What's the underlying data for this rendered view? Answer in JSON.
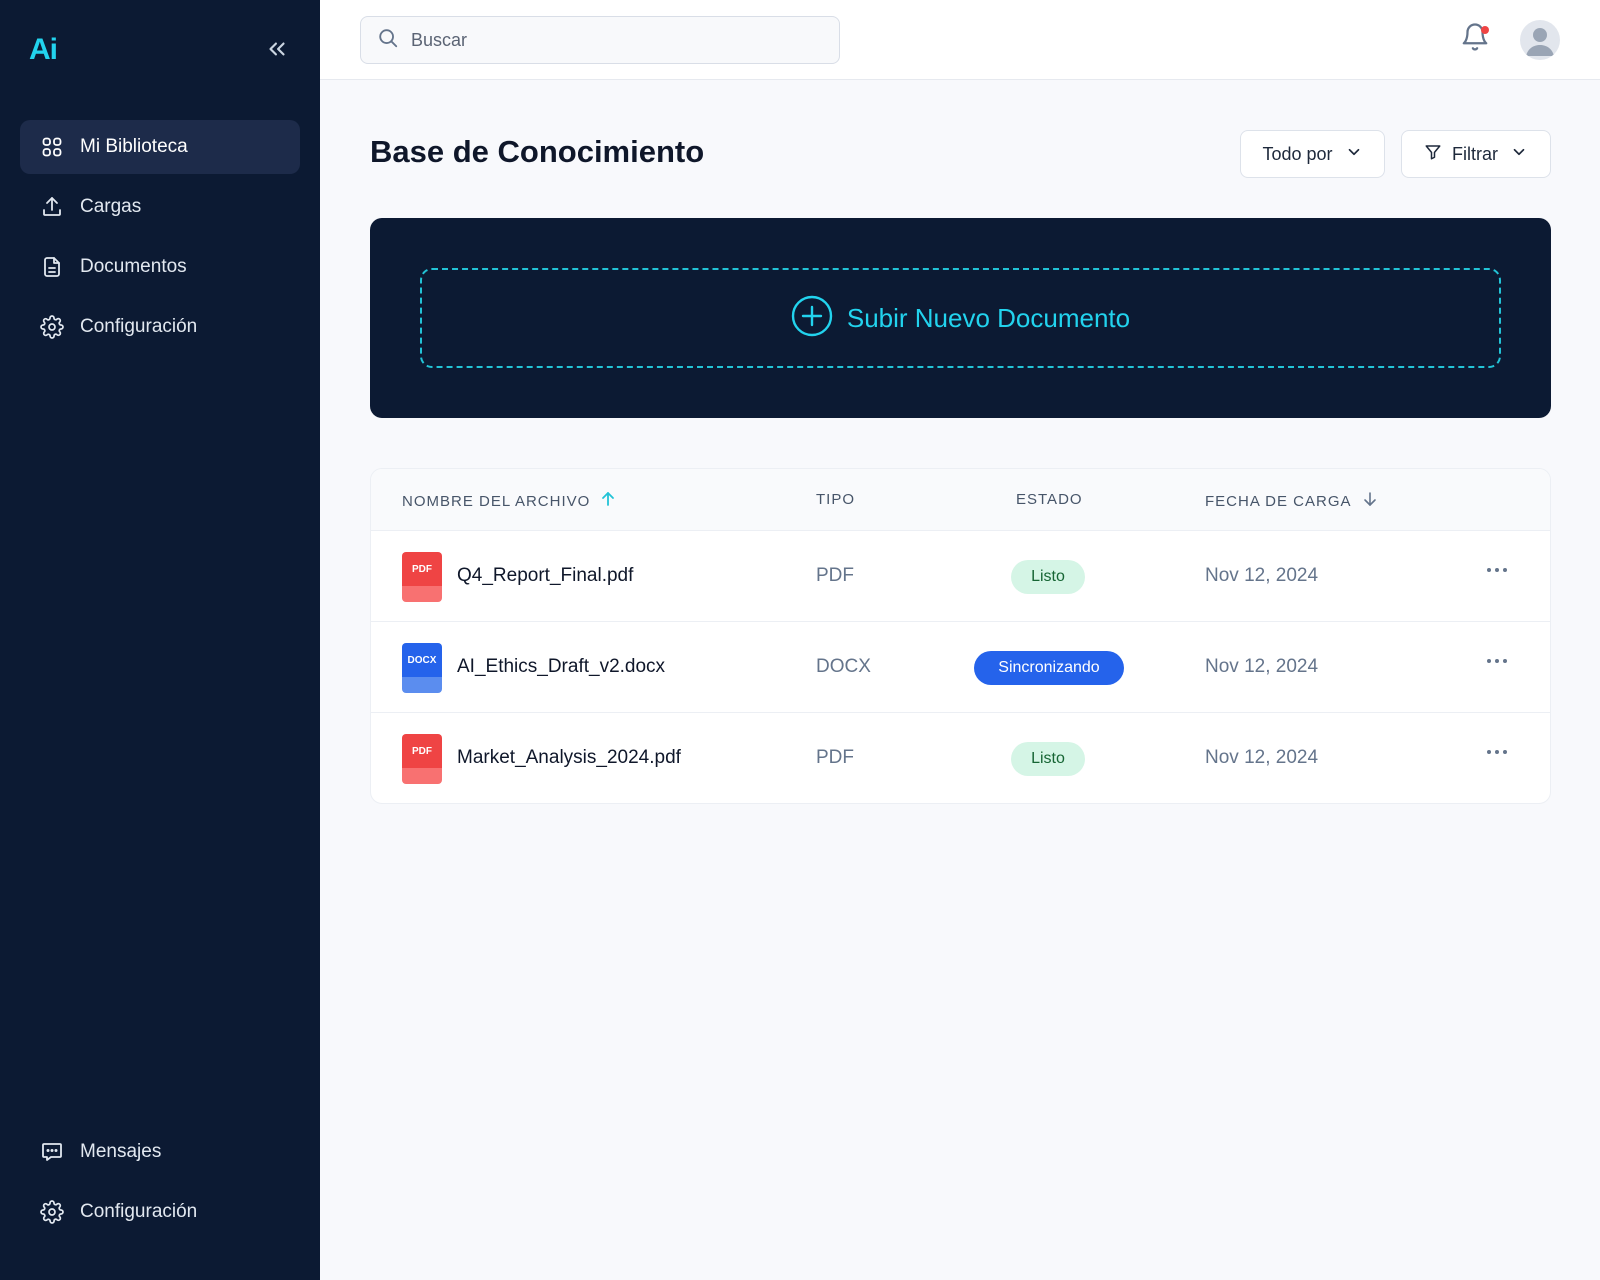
{
  "brand": {
    "logo": "Ai",
    "accent": "#22d3ee",
    "sidebar_bg": "#0c1a33"
  },
  "sidebar": {
    "items": [
      {
        "label": "Mi Biblioteca",
        "icon": "grid-icon",
        "active": true
      },
      {
        "label": "Cargas",
        "icon": "upload-icon",
        "active": false
      },
      {
        "label": "Documentos",
        "icon": "document-icon",
        "active": false
      },
      {
        "label": "Configuración",
        "icon": "gear-icon",
        "active": false
      }
    ],
    "bottom_items": [
      {
        "label": "Mensajes",
        "icon": "message-icon"
      },
      {
        "label": "Configuración",
        "icon": "gear-icon"
      }
    ]
  },
  "topbar": {
    "search_placeholder": "Buscar",
    "notifications_unread": true
  },
  "main": {
    "title": "Base de Conocimiento",
    "sort_label": "Todo por",
    "filter_label": "Filtrar",
    "upload_label": "Subir Nuevo Documento"
  },
  "table": {
    "headers": {
      "name": "NOMBRE DEL ARCHIVO",
      "type": "TIPO",
      "status": "ESTADO",
      "date": "FECHA DE CARGA"
    },
    "rows": [
      {
        "icon": "PDF",
        "name": "Q4_Report_Final.pdf",
        "type": "PDF",
        "status": "Listo",
        "date": "Nov 12, 2024"
      },
      {
        "icon": "DOCX",
        "name": "AI_Ethics_Draft_v2.docx",
        "type": "DOCX",
        "status": "Sincronizando",
        "date": "Nov 12, 2024"
      },
      {
        "icon": "PDF",
        "name": "Market_Analysis_2024.pdf",
        "type": "PDF",
        "status": "Listo",
        "date": "Nov 12, 2024"
      }
    ]
  }
}
